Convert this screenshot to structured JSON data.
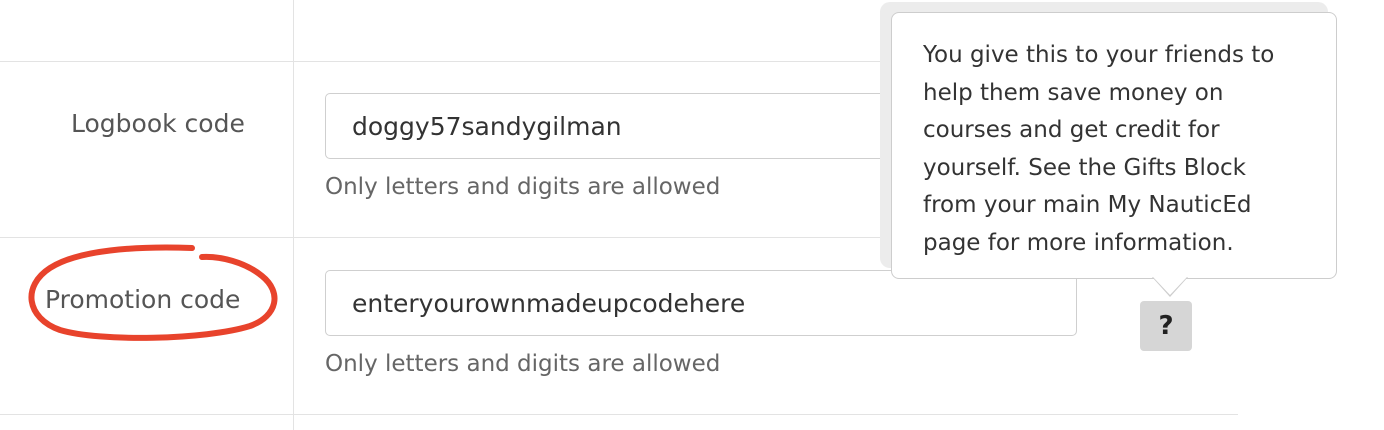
{
  "form": {
    "logbook": {
      "label": "Logbook code",
      "value": "doggy57sandygilman",
      "hint": "Only letters and digits are allowed"
    },
    "promotion": {
      "label": "Promotion code",
      "value": "enteryourownmadeupcodehere",
      "hint": "Only letters and digits are allowed"
    }
  },
  "help": {
    "button_label": "?",
    "tooltip_lines": [
      "You give this to your friends to",
      "help them save money on",
      "courses and get credit for",
      "yourself. See the Gifts Block",
      "from your main My NauticEd",
      "page for more information."
    ]
  },
  "annotation": {
    "color": "#e8432c"
  }
}
